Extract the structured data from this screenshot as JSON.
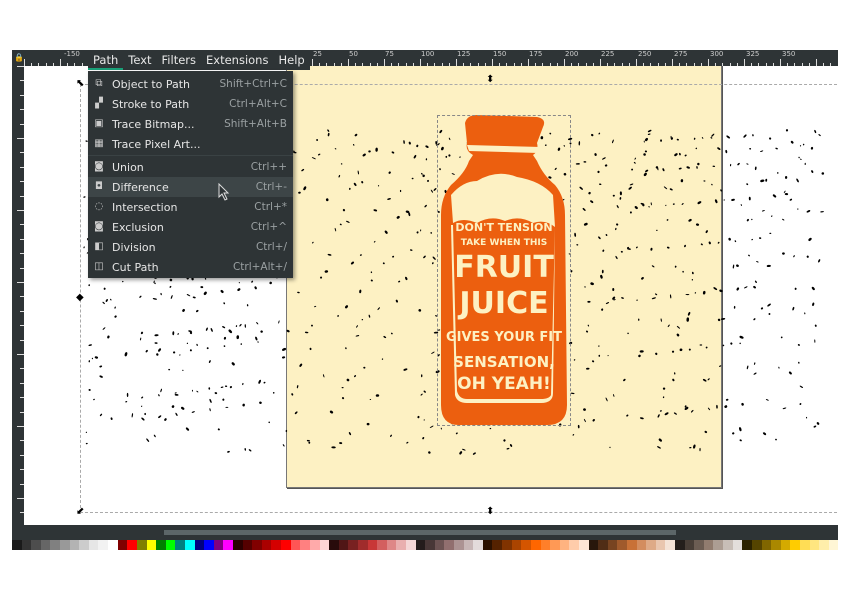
{
  "menubar": {
    "items": [
      "Path",
      "Text",
      "Filters",
      "Extensions",
      "Help"
    ],
    "active": "Path"
  },
  "path_menu": {
    "items": [
      {
        "label": "Object to Path",
        "shortcut": "Shift+Ctrl+C",
        "icon": "object-to-path-icon"
      },
      {
        "label": "Stroke to Path",
        "shortcut": "Ctrl+Alt+C",
        "icon": "stroke-to-path-icon"
      },
      {
        "label": "Trace Bitmap...",
        "shortcut": "Shift+Alt+B",
        "icon": "trace-bitmap-icon"
      },
      {
        "label": "Trace Pixel Art...",
        "shortcut": "",
        "icon": "trace-pixel-art-icon"
      },
      {
        "label": "Union",
        "shortcut": "Ctrl++",
        "icon": "union-icon"
      },
      {
        "label": "Difference",
        "shortcut": "Ctrl+-",
        "icon": "difference-icon",
        "highlighted": true
      },
      {
        "label": "Intersection",
        "shortcut": "Ctrl+*",
        "icon": "intersection-icon"
      },
      {
        "label": "Exclusion",
        "shortcut": "Ctrl+^",
        "icon": "exclusion-icon"
      },
      {
        "label": "Division",
        "shortcut": "Ctrl+/",
        "icon": "division-icon"
      },
      {
        "label": "Cut Path",
        "shortcut": "Ctrl+Alt+/",
        "icon": "cut-path-icon"
      }
    ]
  },
  "ruler": {
    "h_labels": [
      "-150",
      "25",
      "50",
      "75",
      "100",
      "125",
      "150",
      "175",
      "200",
      "225",
      "250",
      "275",
      "300",
      "325",
      "350"
    ]
  },
  "artwork": {
    "lines": [
      "DON'T TENSION",
      "TAKE WHEN THIS",
      "FRUIT",
      "JUICE",
      "GIVES YOUR FIT",
      "SENSATION,",
      "OH YEAH!"
    ],
    "colors": {
      "bottle": "#ec5f0f",
      "page": "#fdf1c3",
      "cream": "#fdf1c3"
    }
  },
  "colors": {
    "chrome": "#2e3436",
    "accent": "#1aa179"
  }
}
